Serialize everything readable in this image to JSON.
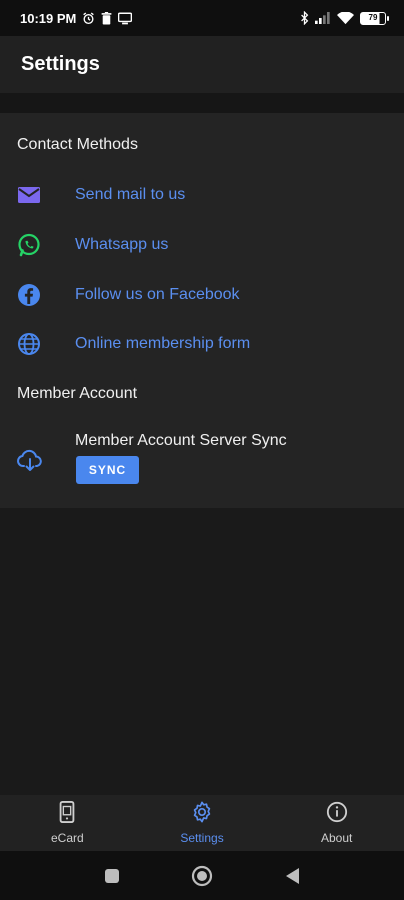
{
  "status_bar": {
    "time": "10:19 PM",
    "battery": "79",
    "icons": [
      "alarm-icon",
      "delete-icon",
      "screen-icon",
      "bluetooth-icon",
      "signal-icon",
      "wifi-icon",
      "battery-icon"
    ]
  },
  "app_bar": {
    "title": "Settings"
  },
  "contact_methods": {
    "header": "Contact Methods",
    "items": [
      {
        "label": "Send mail to us",
        "icon": "mail-icon"
      },
      {
        "label": "Whatsapp us",
        "icon": "whatsapp-icon"
      },
      {
        "label": "Follow us on Facebook",
        "icon": "facebook-icon"
      },
      {
        "label": "Online membership form",
        "icon": "globe-icon"
      }
    ]
  },
  "member_account": {
    "header": "Member Account",
    "sync_title": "Member Account Server Sync",
    "sync_button": "SYNC",
    "icon": "cloud-download-icon"
  },
  "bottom_nav": {
    "items": [
      {
        "label": "eCard",
        "icon": "phone-card-icon",
        "active": false
      },
      {
        "label": "Settings",
        "icon": "gear-icon",
        "active": true
      },
      {
        "label": "About",
        "icon": "info-icon",
        "active": false
      }
    ]
  },
  "colors": {
    "accent": "#5b8ff0",
    "sync_button": "#4a87ee",
    "mail_icon": "#7b68ee",
    "whatsapp_icon": "#25d366",
    "facebook_icon": "#4a87ee",
    "globe_icon": "#4a87ee"
  }
}
